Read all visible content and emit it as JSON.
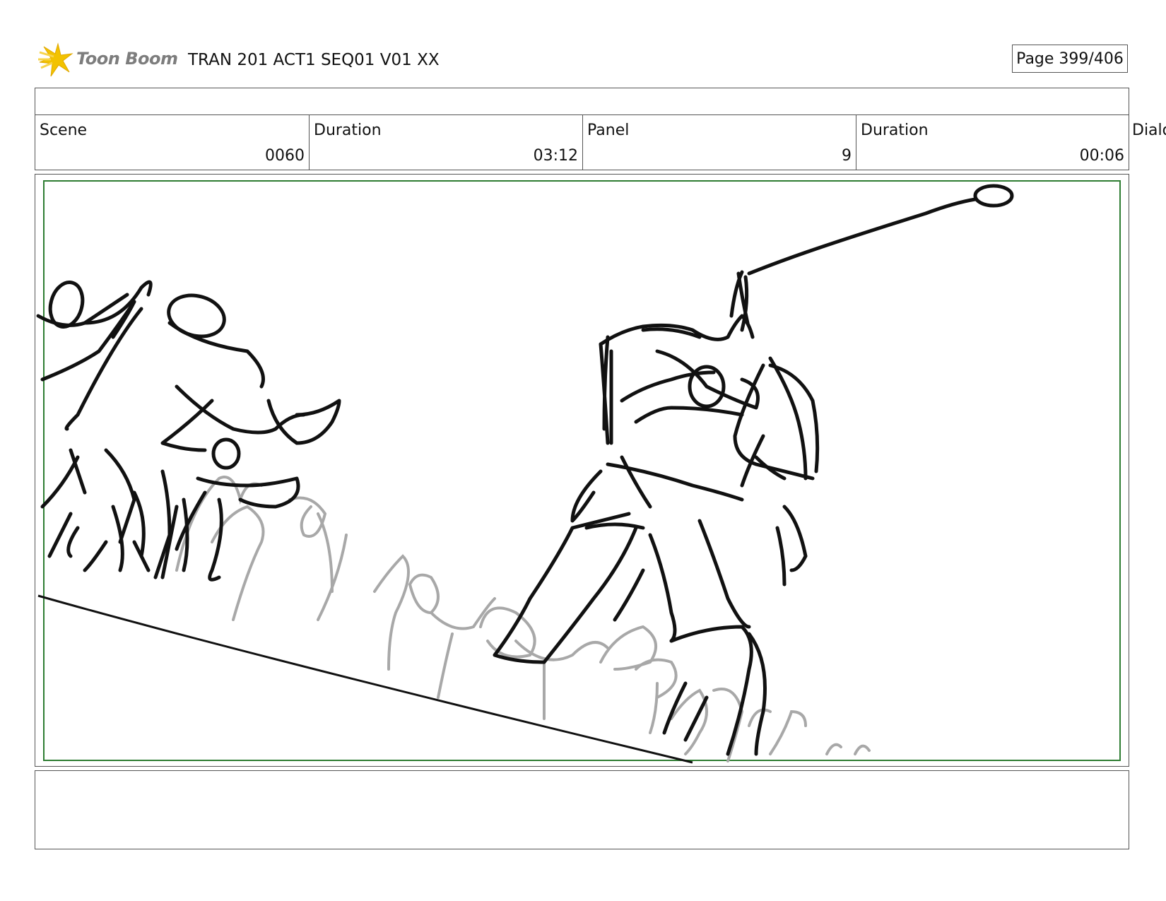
{
  "header": {
    "logo_text": "Toon Boom",
    "title": "TRAN 201 ACT1 SEQ01 V01 XX",
    "page": "Page 399/406"
  },
  "info": {
    "scene_label": "Scene",
    "scene_value": "0060",
    "scene_duration_label": "Duration",
    "scene_duration_value": "03:12",
    "panel_label": "Panel",
    "panel_value": "9",
    "panel_duration_label": "Duration",
    "panel_duration_value": "00:06",
    "dialog_label": "Dialo"
  },
  "colors": {
    "safe_frame": "#2e7d32",
    "sketch_primary": "#111111",
    "sketch_secondary": "#a8a8a8",
    "logo_star": "#f2c200"
  },
  "icons": [
    "toon-boom-star-icon"
  ]
}
